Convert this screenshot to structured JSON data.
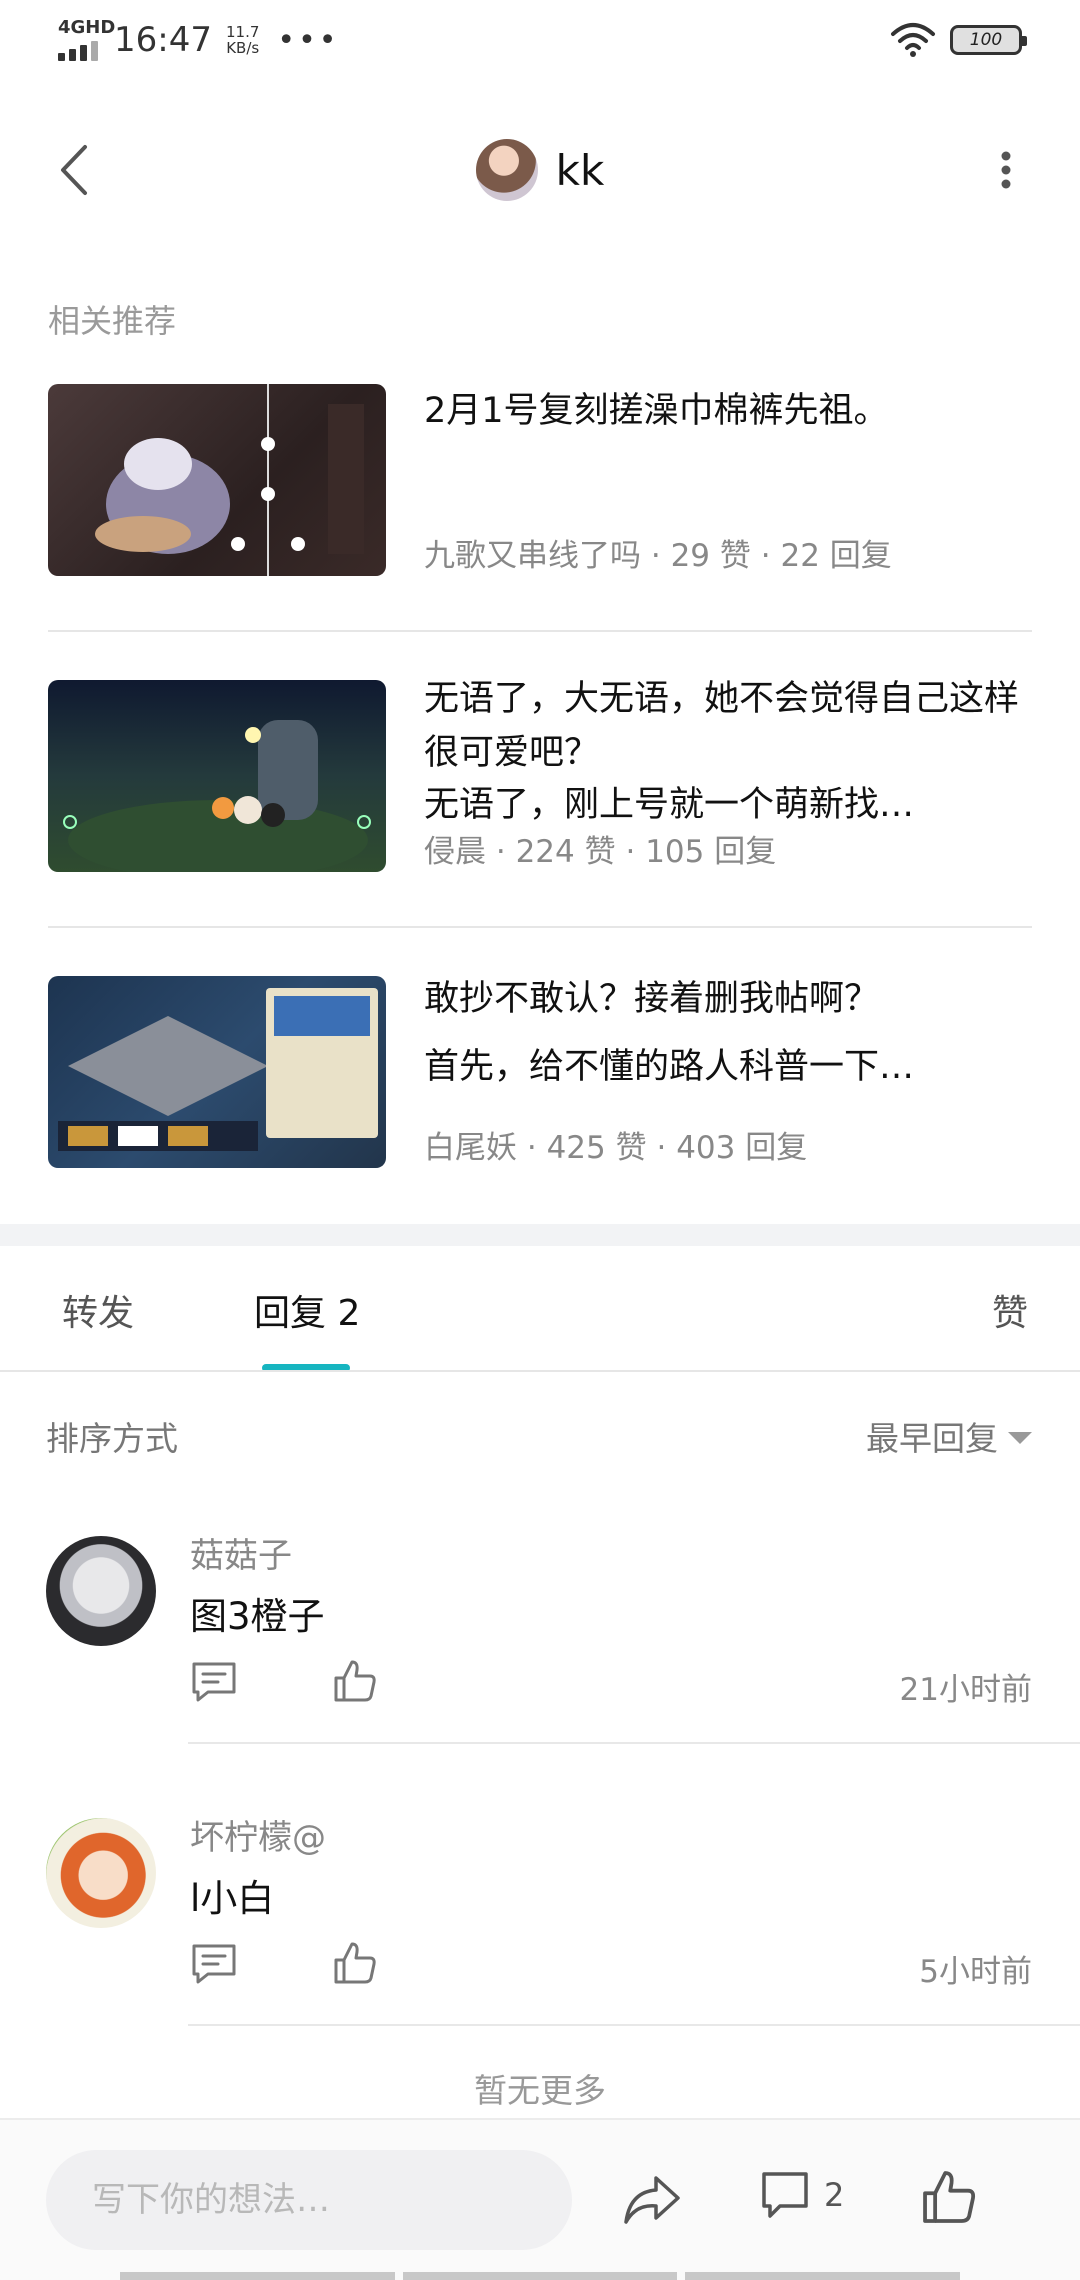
{
  "status_bar": {
    "network": "4GHD",
    "time": "16:47",
    "speed_value": "11.7",
    "speed_unit": "KB/s",
    "dots": "•••",
    "battery": "100"
  },
  "header": {
    "username": "kk"
  },
  "related": {
    "title": "相关推荐",
    "items": [
      {
        "title": "2月1号复刻搓澡巾棉裤先祖。",
        "subtitle": "",
        "author": "九歌又串线了吗",
        "likes": "29 赞",
        "replies": "22 回复"
      },
      {
        "title": "无语了，大无语，她不会觉得自己这样很可爱吧？",
        "subtitle": "无语了，刚上号就一个萌新找…",
        "author": "侵晨",
        "likes": "224 赞",
        "replies": "105 回复"
      },
      {
        "title": "敢抄不敢认？接着删我帖啊？",
        "subtitle": "首先，给不懂的路人科普一下…",
        "author": "白尾妖",
        "likes": "425 赞",
        "replies": "403 回复"
      }
    ],
    "meta_separator": "·"
  },
  "tabs": {
    "forward": "转发",
    "reply": "回复 2",
    "like": "赞"
  },
  "sort": {
    "label": "排序方式",
    "value": "最早回复"
  },
  "comments": [
    {
      "name": "菇菇子",
      "text": "图3橙子",
      "time": "21小时前"
    },
    {
      "name": "坏柠檬@",
      "text": "l小白",
      "time": "5小时前"
    }
  ],
  "no_more": "暂无更多",
  "bottom_bar": {
    "input_placeholder": "写下你的想法…",
    "comment_count": "2"
  },
  "colors": {
    "accent": "#16b5c0",
    "muted_text": "#888888",
    "divider": "#e6e6e6"
  }
}
